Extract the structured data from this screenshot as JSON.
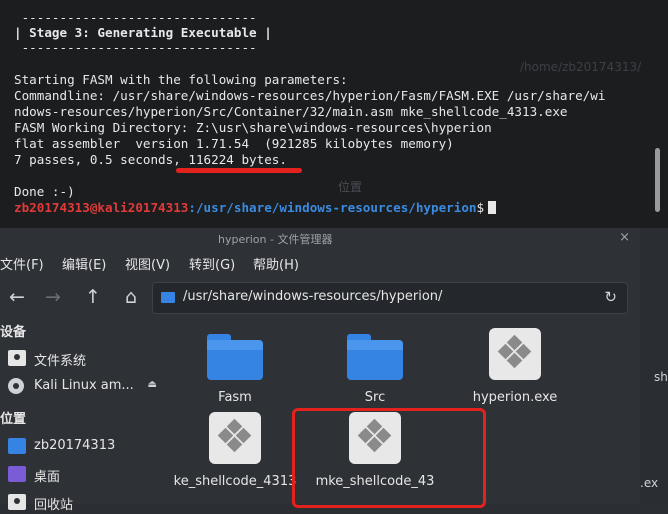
{
  "terminal": {
    "lines": [
      " -------------------------------",
      "| Stage 3: Generating Executable |",
      " -------------------------------",
      "",
      "Starting FASM with the following parameters:",
      "Commandline: /usr/share/windows-resources/hyperion/Fasm/FASM.EXE /usr/share/wi",
      "ndows-resources/hyperion/Src/Container/32/main.asm mke_shellcode_4313.exe",
      "FASM Working Directory: Z:\\usr\\share\\windows-resources\\hyperion",
      "flat assembler  version 1.71.54  (921285 kilobytes memory)",
      "7 passes, 0.5 seconds, 116224 bytes.",
      "",
      "Done :-)"
    ],
    "prompt_user": "zb20174313@kali20174313",
    "prompt_path": ":/usr/share/windows-resources/hyperion",
    "prompt_symbol": "$"
  },
  "file_manager": {
    "title": "hyperion - 文件管理器",
    "close": "×",
    "menu": [
      "文件(F)",
      "编辑(E)",
      "视图(V)",
      "转到(G)",
      "帮助(H)"
    ],
    "location": "/usr/share/windows-resources/hyperion/",
    "sidebar": {
      "devices_header": "设备",
      "devices": [
        {
          "label": "文件系统",
          "icon": "drive-icon"
        },
        {
          "label": "Kali Linux am...",
          "icon": "disc-icon"
        }
      ],
      "places_header": "位置",
      "places": [
        {
          "label": "zb20174313",
          "icon": "folder-icon"
        },
        {
          "label": "桌面",
          "icon": "desktop-icon"
        },
        {
          "label": "回收站",
          "icon": "trash-icon"
        }
      ]
    },
    "files": [
      {
        "name": "Fasm",
        "type": "folder"
      },
      {
        "name": "Src",
        "type": "folder"
      },
      {
        "name": "hyperion.exe",
        "type": "exe"
      },
      {
        "name": "ke_shellcode_4313",
        "type": "exe"
      },
      {
        "name": "mke_shellcode_43",
        "type": "exe"
      }
    ]
  },
  "background": {
    "right_text_1": "sh",
    "right_text_2": ".ex",
    "faint_path": "/home/zb20174313/",
    "faint_pos": "位置"
  },
  "colors": {
    "terminal_bg": "#1b1d1f",
    "prompt_user": "#e23a3a",
    "prompt_path": "#3b8be0",
    "folder_blue": "#3584e4",
    "highlight_red": "#e4221d"
  }
}
